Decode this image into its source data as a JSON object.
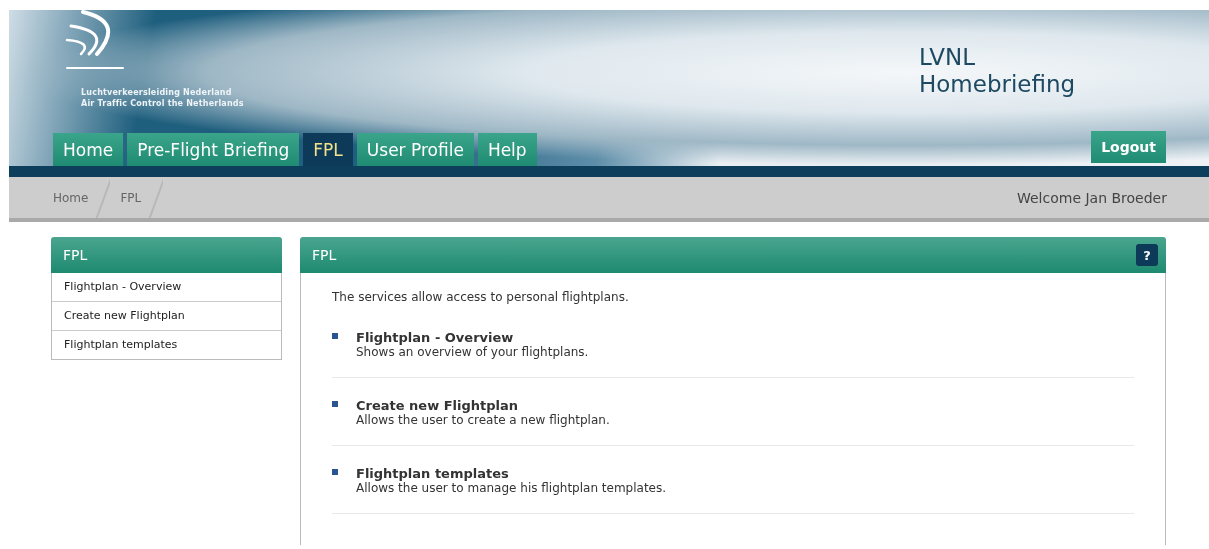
{
  "header": {
    "logo_lines": [
      "Luchtverkeersleiding Nederland",
      "Air Traffic Control the Netherlands"
    ],
    "title_lines": [
      "LVNL",
      "Homebriefing"
    ],
    "logout": "Logout"
  },
  "nav_tabs": [
    {
      "label": "Home",
      "selected": false
    },
    {
      "label": "Pre-Flight Briefing",
      "selected": false
    },
    {
      "label": "FPL",
      "selected": true
    },
    {
      "label": "User Profile",
      "selected": false
    },
    {
      "label": "Help",
      "selected": false
    }
  ],
  "breadcrumb": {
    "items": [
      "Home",
      "FPL"
    ],
    "welcome": "Welcome Jan Broeder"
  },
  "sidebar": {
    "title": "FPL",
    "items": [
      "Flightplan - Overview",
      "Create new Flightplan",
      "Flightplan templates"
    ]
  },
  "panel": {
    "title": "FPL",
    "help": "?",
    "intro": "The services allow access to personal flightplans.",
    "services": [
      {
        "title": "Flightplan - Overview",
        "description": "Shows an overview of your flightplans."
      },
      {
        "title": "Create new Flightplan",
        "description": "Allows the user to create a new flightplan."
      },
      {
        "title": "Flightplan templates",
        "description": "Allows the user to manage his flightplan templates."
      }
    ]
  }
}
